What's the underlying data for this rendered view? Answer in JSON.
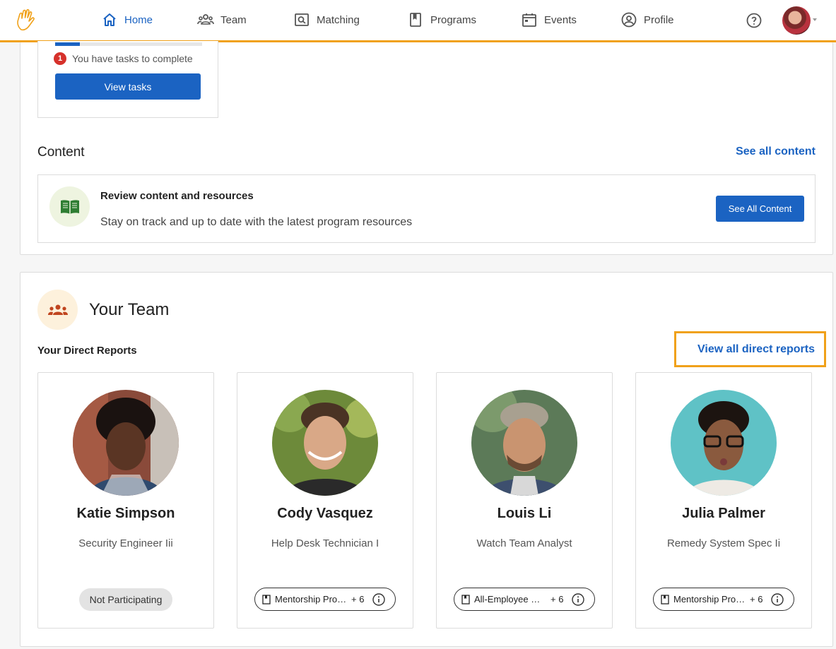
{
  "nav": {
    "items": [
      {
        "label": "Home",
        "icon": "home-icon",
        "active": true
      },
      {
        "label": "Team",
        "icon": "team-icon"
      },
      {
        "label": "Matching",
        "icon": "matching-icon"
      },
      {
        "label": "Programs",
        "icon": "programs-icon"
      },
      {
        "label": "Events",
        "icon": "calendar-icon"
      },
      {
        "label": "Profile",
        "icon": "profile-icon"
      }
    ],
    "accent_color": "#f0a11a",
    "primary_color": "#1b63c2"
  },
  "tasks": {
    "badge_count": "1",
    "message": "You have tasks to complete",
    "button_label": "View tasks"
  },
  "content": {
    "section_title": "Content",
    "see_all_link": "See all content",
    "card_title": "Review content and resources",
    "card_description": "Stay on track and up to date with the latest program resources",
    "button_label": "See All Content"
  },
  "team": {
    "title": "Your Team",
    "subtitle": "Your Direct Reports",
    "view_all_link": "View all direct reports",
    "reports": [
      {
        "name": "Katie Simpson",
        "role": "Security Engineer Iii",
        "status": "Not Participating"
      },
      {
        "name": "Cody Vasquez",
        "role": "Help Desk Technician I",
        "program": "Mentorship Program",
        "more": "+ 6"
      },
      {
        "name": "Louis Li",
        "role": "Watch Team Analyst",
        "program": "All-Employee @ Work",
        "more": "+ 6"
      },
      {
        "name": "Julia Palmer",
        "role": "Remedy System Spec Ii",
        "program": "Mentorship Program",
        "more": "+ 6"
      }
    ]
  }
}
